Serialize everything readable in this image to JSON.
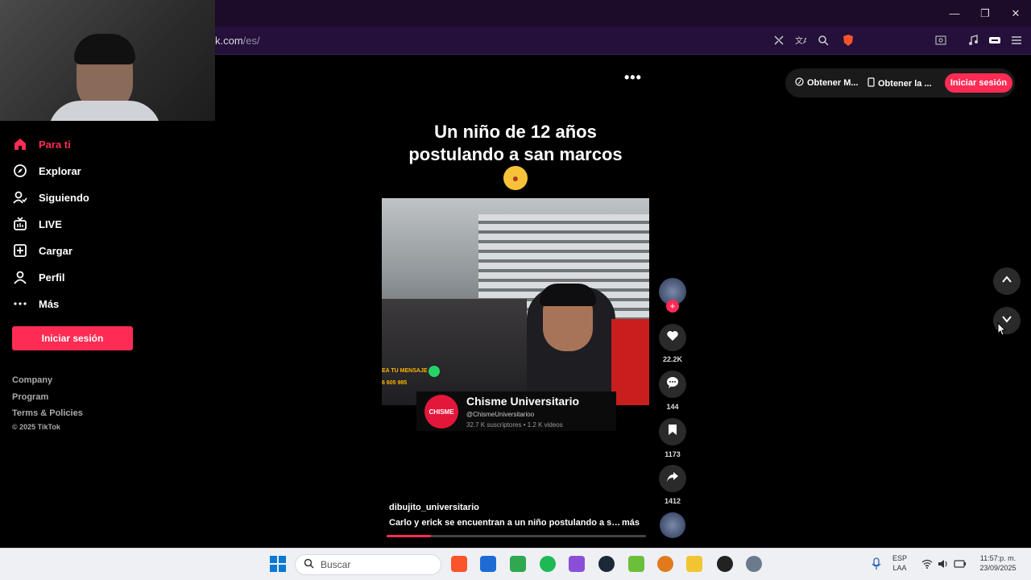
{
  "browser": {
    "url_visible": "k.com",
    "url_path": "/es/",
    "window_controls": [
      "minimize",
      "restore",
      "close"
    ]
  },
  "sidebar": {
    "items": [
      {
        "label": "Para ti",
        "icon": "home-icon",
        "active": true
      },
      {
        "label": "Explorar",
        "icon": "compass-icon"
      },
      {
        "label": "Siguiendo",
        "icon": "following-icon"
      },
      {
        "label": "LIVE",
        "icon": "live-tv-icon"
      },
      {
        "label": "Cargar",
        "icon": "upload-icon"
      },
      {
        "label": "Perfil",
        "icon": "profile-icon"
      },
      {
        "label": "Más",
        "icon": "more-dots-icon"
      }
    ],
    "login_button": "Iniciar sesión",
    "footer_links": [
      "Company",
      "Program",
      "Terms & Policies"
    ],
    "copyright": "© 2025 TikTok"
  },
  "header": {
    "get_app_1": "Obtener M...",
    "get_app_2": "Obtener la ...",
    "login_button": "Iniciar sesión"
  },
  "video": {
    "title_line1": "Un niño de 12 años",
    "title_line2": "postulando a san marcos",
    "overlay_text_1": "EA TU MENSAJE",
    "overlay_text_2": "6 605 985",
    "channel_name": "Chisme Universitario",
    "channel_logo_text": "CHISME",
    "channel_handle": "@ChismeUniversitarioo",
    "channel_stats": "32.7 K suscriptores • 1.2 K videos",
    "author": "dibujito_universitario",
    "description": "Carlo y erick se encuentran a un niño postulando a san ...",
    "more": "más",
    "progress": 0.17
  },
  "actions": {
    "likes": "22.2K",
    "comments": "144",
    "saves": "1173",
    "shares": "1412"
  },
  "taskbar": {
    "search_placeholder": "Buscar",
    "lang": "ESP",
    "lang_sub": "LAA",
    "time": "11:57:p. m.",
    "date": "23/09/2025"
  },
  "colors": {
    "accent": "#fe2c55",
    "browser_bg": "#24103a"
  }
}
